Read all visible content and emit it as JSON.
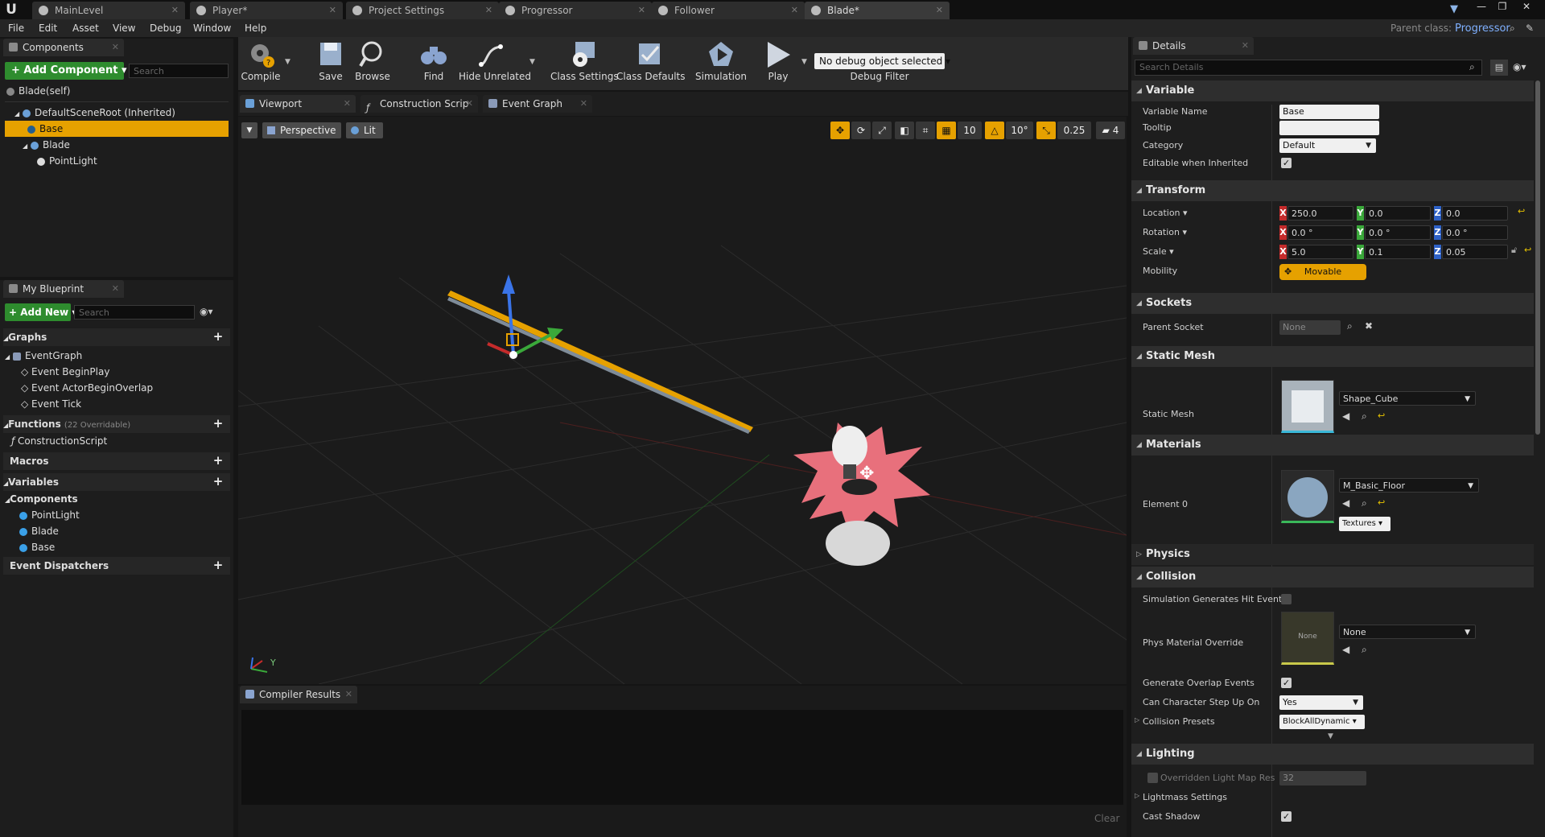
{
  "titlebar": {
    "tabs": [
      "MainLevel",
      "Player*",
      "Project Settings",
      "Progressor",
      "Follower",
      "Blade*"
    ],
    "parent_class_label": "Parent class:",
    "parent_class_value": "Progressor"
  },
  "menu": [
    "File",
    "Edit",
    "Asset",
    "View",
    "Debug",
    "Window",
    "Help"
  ],
  "components": {
    "tab": "Components",
    "add_button": "+ Add Component ▾",
    "search_placeholder": "Search",
    "self_label": "Blade(self)",
    "tree": [
      {
        "label": "DefaultSceneRoot (Inherited)",
        "indent": 0
      },
      {
        "label": "Base",
        "indent": 1,
        "selected": true
      },
      {
        "label": "Blade",
        "indent": 1
      },
      {
        "label": "PointLight",
        "indent": 2
      }
    ]
  },
  "blueprint": {
    "tab": "My Blueprint",
    "add_button": "+ Add New ▾",
    "search_placeholder": "Search",
    "graphs_header": "Graphs",
    "event_graph": "EventGraph",
    "events": [
      "Event BeginPlay",
      "Event ActorBeginOverlap",
      "Event Tick"
    ],
    "functions_header": "Functions",
    "functions_note": "(22 Overridable)",
    "construction_script": "ConstructionScript",
    "macros_header": "Macros",
    "variables_header": "Variables",
    "components_header": "Components",
    "variables": [
      "PointLight",
      "Blade",
      "Base"
    ],
    "dispatchers_header": "Event Dispatchers"
  },
  "toolbar": {
    "compile": "Compile",
    "save": "Save",
    "browse": "Browse",
    "find": "Find",
    "hide_unrelated": "Hide Unrelated",
    "class_settings": "Class Settings",
    "class_defaults": "Class Defaults",
    "simulation": "Simulation",
    "play": "Play",
    "debug_select": "No debug object selected ▾",
    "debug_filter": "Debug Filter"
  },
  "editor_tabs": [
    "Viewport",
    "Construction Scrip",
    "Event Graph"
  ],
  "viewport": {
    "perspective": "Perspective",
    "lit": "Lit",
    "grid_snap": "10",
    "rot_snap": "10°",
    "scale_snap": "0.25",
    "cam_speed": "4",
    "axis_y": "Y"
  },
  "compiler": {
    "tab": "Compiler Results",
    "clear": "Clear"
  },
  "details": {
    "tab": "Details",
    "search_placeholder": "Search Details",
    "sections": {
      "variable": "Variable",
      "transform": "Transform",
      "sockets": "Sockets",
      "static_mesh": "Static Mesh",
      "materials": "Materials",
      "physics": "Physics",
      "collision": "Collision",
      "lighting": "Lighting"
    },
    "variable_name_label": "Variable Name",
    "variable_name": "Base",
    "tooltip_label": "Tooltip",
    "category_label": "Category",
    "category": "Default",
    "editable_label": "Editable when Inherited",
    "location_label": "Location ▾",
    "location": [
      "250.0",
      "0.0",
      "0.0"
    ],
    "rotation_label": "Rotation ▾",
    "rotation": [
      "0.0 °",
      "0.0 °",
      "0.0 °"
    ],
    "scale_label": "Scale ▾",
    "scale": [
      "5.0",
      "0.1",
      "0.05"
    ],
    "mobility_label": "Mobility",
    "mobility": "Movable",
    "parent_socket_label": "Parent Socket",
    "parent_socket": "None",
    "static_mesh_label": "Static Mesh",
    "static_mesh": "Shape_Cube",
    "element0_label": "Element 0",
    "material": "M_Basic_Floor",
    "textures": "Textures ▾",
    "sim_hit_label": "Simulation Generates Hit Event",
    "phys_mat_label": "Phys Material Override",
    "phys_mat_thumb": "None",
    "phys_mat": "None",
    "overlap_label": "Generate Overlap Events",
    "step_up_label": "Can Character Step Up On",
    "step_up": "Yes",
    "presets_label": "Collision Presets",
    "presets": "BlockAllDynamic ▾",
    "lightmap_label": "Overridden Light Map Res",
    "lightmap": "32",
    "lightmass_label": "Lightmass Settings",
    "cast_shadow_label": "Cast Shadow"
  },
  "colors": {
    "accent": "#e6a100",
    "green": "#2e8c2e",
    "panel": "#1d1d1d"
  }
}
